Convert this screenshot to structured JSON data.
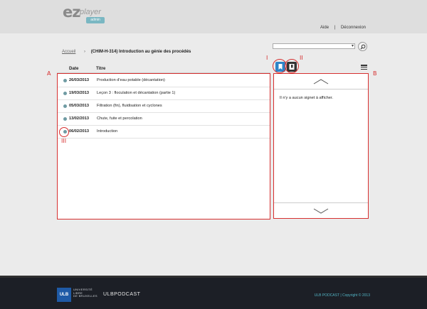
{
  "app": {
    "logo_main": "ez",
    "logo_sub": "player",
    "logo_badge": "admin"
  },
  "topnav": {
    "help": "Aide",
    "separator": "|",
    "logout": "Déconnexion"
  },
  "breadcrumb": {
    "home": "Accueil",
    "current": "(CHIM-H-314) Introduction au génie des procédés"
  },
  "table": {
    "headers": {
      "date": "Date",
      "title": "Titre"
    },
    "rows": [
      {
        "date": "26/03/2013",
        "title": "Production d'eau potable (décantation)"
      },
      {
        "date": "19/03/2013",
        "title": "Leçon 3 : floculation et décantation (partie 1)"
      },
      {
        "date": "05/03/2013",
        "title": "Filtration (fin), fluidisation et cyclones"
      },
      {
        "date": "13/02/2013",
        "title": "Chute, fuite et percolation"
      },
      {
        "date": "06/02/2013",
        "title": "Introduction"
      }
    ]
  },
  "panel": {
    "empty_message": "Il n'y a aucun signet à afficher."
  },
  "annotations": {
    "A": "A",
    "B": "B",
    "I": "I",
    "II": "II",
    "III": "III"
  },
  "footer": {
    "ulb": "ULB",
    "university_line1": "UNIVERSITÉ",
    "university_line2": "LIBRE",
    "university_line3": "DE BRUXELLES",
    "podcast": "ULBPODCAST",
    "copyright": "ULB PODCAST | Copyright © 2013"
  },
  "colors": {
    "annotation": "#d63030",
    "accent_blue": "#2d84c8",
    "dot": "#6f9ba3",
    "footer_bg": "#1c1f26",
    "footer_link": "#52b4c4"
  }
}
